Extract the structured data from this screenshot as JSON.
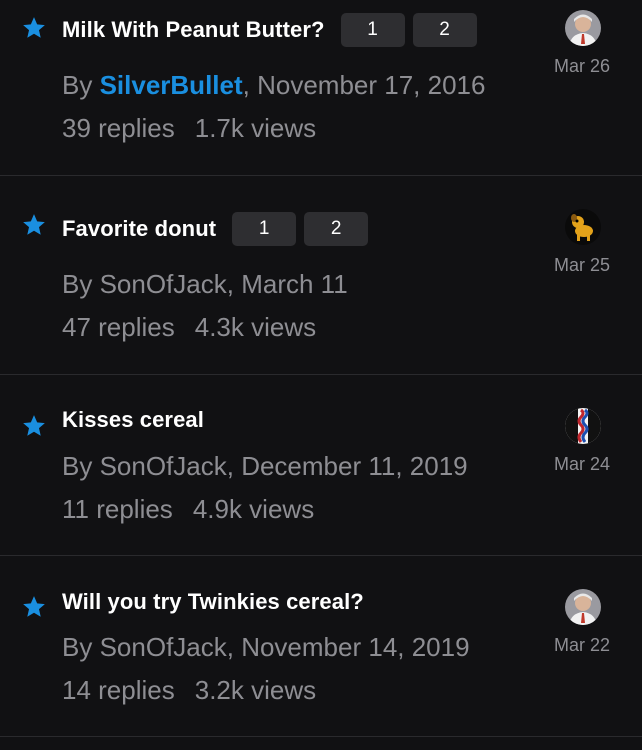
{
  "topics": [
    {
      "title": "Milk With Peanut Butter?",
      "pages": [
        "1",
        "2"
      ],
      "by": "By ",
      "author": "SilverBullet",
      "date": ", November 17, 2016",
      "replies": "39 replies",
      "views": "1.7k views",
      "last_activity": "Mar 26",
      "avatar_icon": "man-photo-avatar"
    },
    {
      "title": "Favorite donut",
      "pages": [
        "1",
        "2"
      ],
      "by": "By ",
      "author": "SonOfJack",
      "date": ", March 11",
      "replies": "47 replies",
      "views": "4.3k views",
      "last_activity": "Mar 25",
      "avatar_icon": "cartoon-dog-avatar"
    },
    {
      "title": "Kisses cereal",
      "pages": [],
      "by": "By ",
      "author": "SonOfJack",
      "date": ", December 11, 2019",
      "replies": "11 replies",
      "views": "4.9k views",
      "last_activity": "Mar 24",
      "avatar_icon": "wavy-flag-avatar"
    },
    {
      "title": "Will you try Twinkies cereal?",
      "pages": [],
      "by": "By ",
      "author": "SonOfJack",
      "date": ", November 14, 2019",
      "replies": "14 replies",
      "views": "3.2k views",
      "last_activity": "Mar 22",
      "avatar_icon": "man-photo-avatar"
    }
  ],
  "colors": {
    "background": "#111113",
    "star": "#1a8fe0",
    "link": "#1a8fe0",
    "muted_text": "#8e8e93",
    "badge_bg": "#2e2e31"
  }
}
